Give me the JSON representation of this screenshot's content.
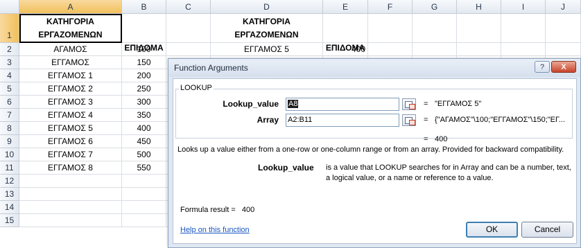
{
  "columns": [
    "A",
    "B",
    "C",
    "D",
    "E",
    "F",
    "G",
    "H",
    "I",
    "J"
  ],
  "rows": [
    "1",
    "2",
    "3",
    "4",
    "5",
    "6",
    "7",
    "8",
    "9",
    "10",
    "11",
    "12",
    "13",
    "14",
    "15"
  ],
  "header": {
    "a1_line1": "ΚΑΤΗΓΟΡΙΑ",
    "a1_line2": "ΕΡΓΑΖΟΜΕΝΩΝ",
    "b1": "ΕΠΙΔΟΜΑ",
    "d1_line1": "ΚΑΤΗΓΟΡΙΑ",
    "d1_line2": "ΕΡΓΑΖΟΜΕΝΩΝ",
    "e1": "ΕΠΙΔΟΜΑ"
  },
  "table": [
    {
      "cat": "ΑΓΑΜΟΣ",
      "amount": "100"
    },
    {
      "cat": "ΕΓΓΑΜΟΣ",
      "amount": "150"
    },
    {
      "cat": "ΕΓΓΑΜΟΣ 1",
      "amount": "200"
    },
    {
      "cat": "ΕΓΓΑΜΟΣ 2",
      "amount": "250"
    },
    {
      "cat": "ΕΓΓΑΜΟΣ 3",
      "amount": "300"
    },
    {
      "cat": "ΕΓΓΑΜΟΣ 4",
      "amount": "350"
    },
    {
      "cat": "ΕΓΓΑΜΟΣ 5",
      "amount": "400"
    },
    {
      "cat": "ΕΓΓΑΜΟΣ 6",
      "amount": "450"
    },
    {
      "cat": "ΕΓΓΑΜΟΣ 7",
      "amount": "500"
    },
    {
      "cat": "ΕΓΓΑΜΟΣ 8",
      "amount": "550"
    }
  ],
  "lookup_row": {
    "cat": "ΕΓΓΑΜΟΣ 5",
    "amount": "400"
  },
  "dialog": {
    "title": "Function Arguments",
    "help_glyph": "?",
    "close_glyph": "X",
    "function_name": "LOOKUP",
    "lookup_value_label": "Lookup_value",
    "lookup_value_input": "A8",
    "lookup_value_result": "\"ΕΓΓΑΜΟΣ 5\"",
    "array_label": "Array",
    "array_input": "A2:B11",
    "array_result": "{\"ΑΓΑΜΟΣ\"\\100;\"ΕΓΓΑΜΟΣ\"\\150;\"ΕΓ...",
    "eq_sign": "=",
    "overall_result": "400",
    "description": "Looks up a value either from a one-row or one-column range or from an array. Provided for backward compatibility.",
    "arg_name": "Lookup_value",
    "arg_description": "is a value that LOOKUP searches for in Array and can be a number, text, a logical value, or a name or reference to a value.",
    "formula_result_label": "Formula result =",
    "formula_result_value": "400",
    "help_link": "Help on this function",
    "ok_label": "OK",
    "cancel_label": "Cancel"
  }
}
